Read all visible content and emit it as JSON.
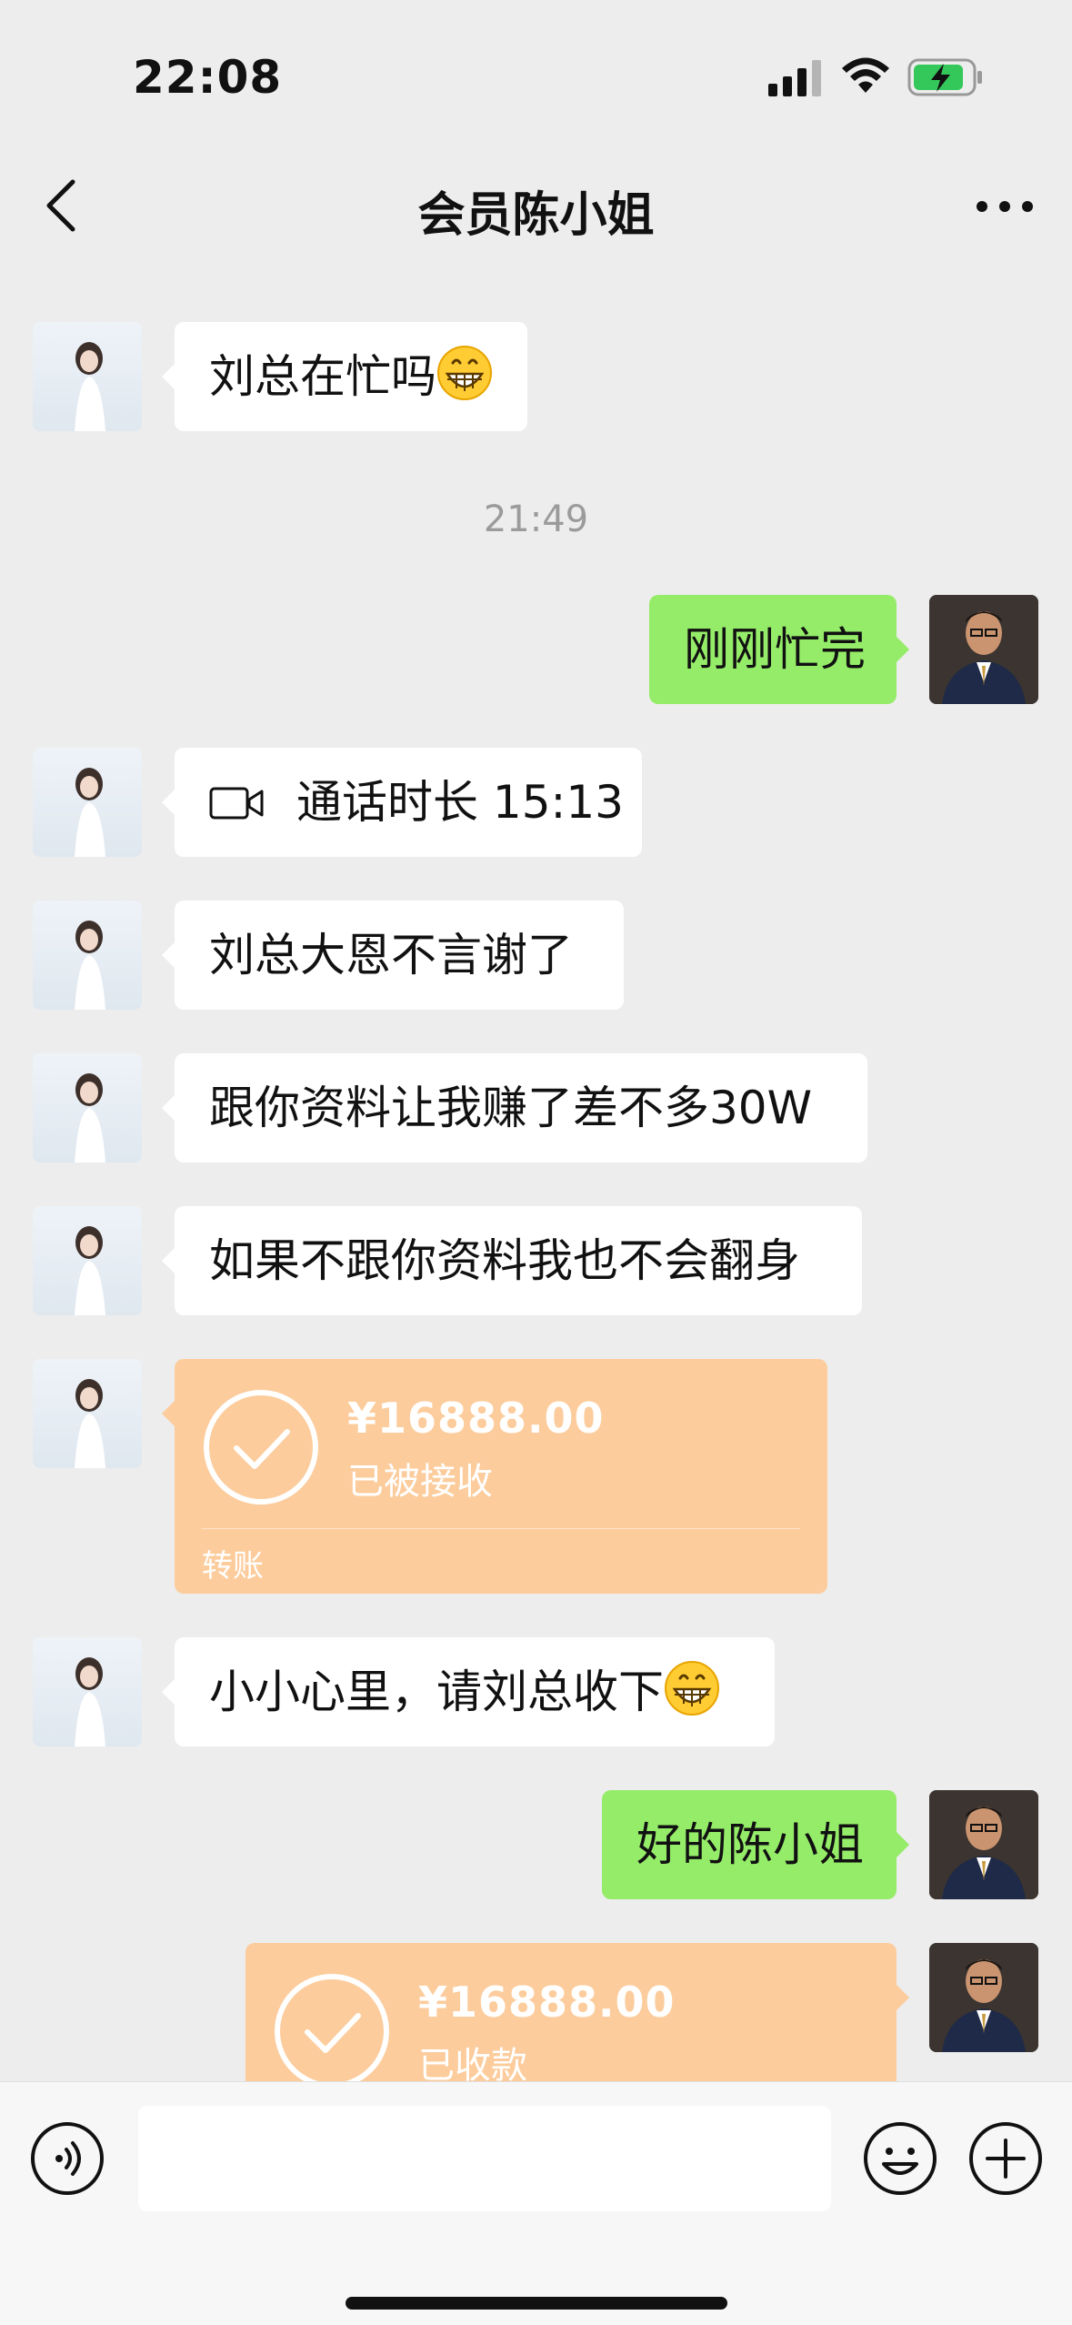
{
  "status_bar": {
    "time": "22:08"
  },
  "nav": {
    "title": "会员陈小姐"
  },
  "messages": {
    "m1": {
      "text": "刘总在忙吗"
    },
    "timestamp": "21:49",
    "m2": {
      "text": "刚刚忙完"
    },
    "m3": {
      "text": "通话时长 15:13"
    },
    "m4": {
      "text": "刘总大恩不言谢了"
    },
    "m5": {
      "text": "跟你资料让我赚了差不多30W"
    },
    "m6": {
      "text": "如果不跟你资料我也不会翻身"
    },
    "transfer1": {
      "amount": "¥16888.00",
      "status": "已被接收",
      "label": "转账"
    },
    "m7": {
      "text": "小小心里，请刘总收下"
    },
    "m8": {
      "text": "好的陈小姐"
    },
    "transfer2": {
      "amount": "¥16888.00",
      "status": "已收款"
    }
  },
  "input": {
    "placeholder": ""
  },
  "colors": {
    "background": "#ededed",
    "sent_bubble": "#95ec69",
    "received_bubble": "#ffffff",
    "transfer_card": "#fccc9c",
    "battery_fill": "#34c759"
  },
  "icons": [
    "signal-icon",
    "wifi-icon",
    "battery-charging-icon",
    "back-icon",
    "more-icon",
    "grin-emoji-icon",
    "video-call-icon",
    "check-circle-icon",
    "voice-icon",
    "emoji-icon",
    "plus-icon"
  ]
}
